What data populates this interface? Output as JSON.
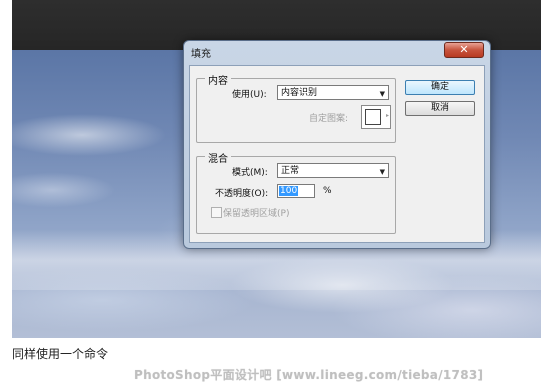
{
  "dialog": {
    "title": "填充",
    "close_icon": "close-icon",
    "content_group": {
      "legend": "内容",
      "use_label": "使用(U):",
      "use_value": "内容识别",
      "custom_pattern_label": "自定图案:"
    },
    "blend_group": {
      "legend": "混合",
      "mode_label": "模式(M):",
      "mode_value": "正常",
      "opacity_label": "不透明度(O):",
      "opacity_value": "100",
      "opacity_unit": "%",
      "preserve_label": "保留透明区域(P)",
      "preserve_checked": false
    },
    "ok_label": "确定",
    "cancel_label": "取消"
  },
  "caption": "同样使用一个命令",
  "watermark": "PhotoShop平面设计吧 [www.lineeg.com/tieba/1783]"
}
